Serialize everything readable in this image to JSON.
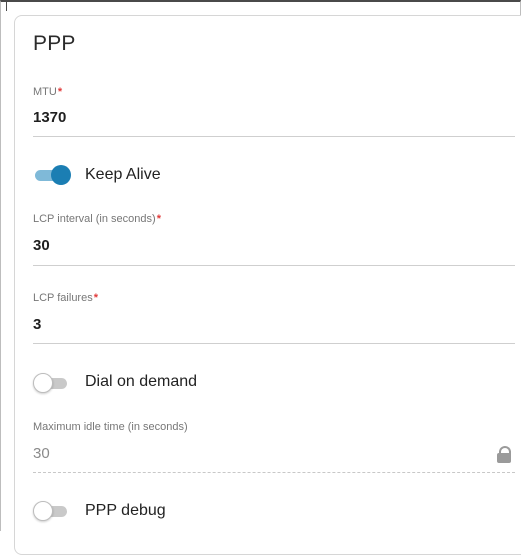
{
  "section": {
    "title": "PPP"
  },
  "fields": {
    "mtu": {
      "label": "MTU",
      "required_mark": "*",
      "value": "1370"
    },
    "lcp_interval": {
      "label": "LCP interval (in seconds)",
      "required_mark": "*",
      "value": "30"
    },
    "lcp_failures": {
      "label": "LCP failures",
      "required_mark": "*",
      "value": "3"
    },
    "max_idle_time": {
      "label": "Maximum idle time (in seconds)",
      "value": "30",
      "locked": true
    }
  },
  "toggles": {
    "keep_alive": {
      "label": "Keep Alive",
      "state": "on"
    },
    "dial_on_demand": {
      "label": "Dial on demand",
      "state": "off"
    },
    "ppp_debug": {
      "label": "PPP debug",
      "state": "off"
    }
  },
  "colors": {
    "accent": "#1b7eb3",
    "required": "#e13b3b"
  },
  "icons": {
    "lock": "lock-icon"
  }
}
